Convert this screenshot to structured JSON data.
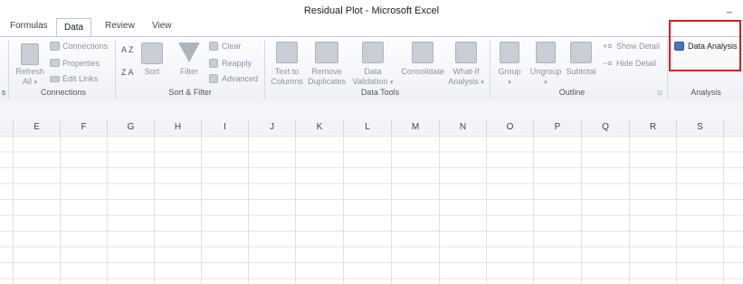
{
  "window": {
    "title": "Residual Plot  -  Microsoft Excel",
    "minimize": "_"
  },
  "tabs": [
    "Formulas",
    "Data",
    "Review",
    "View"
  ],
  "ribbon": {
    "connections_group": {
      "label": "Connections",
      "refresh": "Refresh",
      "refresh_all": "All",
      "connections": "Connections",
      "properties": "Properties",
      "edit_links": "Edit Links"
    },
    "sort_filter_group": {
      "label": "Sort & Filter",
      "sort": "Sort",
      "filter": "Filter",
      "clear": "Clear",
      "reapply": "Reapply",
      "advanced": "Advanced",
      "az": "A Z",
      "za": "Z A"
    },
    "data_tools_group": {
      "label": "Data Tools",
      "text_to_columns_1": "Text to",
      "text_to_columns_2": "Columns",
      "remove_dup_1": "Remove",
      "remove_dup_2": "Duplicates",
      "validation_1": "Data",
      "validation_2": "Validation",
      "consolidate": "Consolidate",
      "whatif_1": "What-If",
      "whatif_2": "Analysis"
    },
    "outline_group": {
      "label": "Outline",
      "group": "Group",
      "ungroup": "Ungroup",
      "subtotal": "Subtotal",
      "show_detail": "Show Detail",
      "hide_detail": "Hide Detail"
    },
    "analysis_group": {
      "label": "Analysis",
      "data_analysis": "Data Analysis"
    },
    "left_cut_label": "s"
  },
  "columns": [
    "E",
    "F",
    "G",
    "H",
    "I",
    "J",
    "K",
    "L",
    "M",
    "N",
    "O",
    "P",
    "Q",
    "R",
    "S"
  ],
  "colors": {
    "highlight": "#e01a1a",
    "tab_border": "#b9c9dc"
  }
}
